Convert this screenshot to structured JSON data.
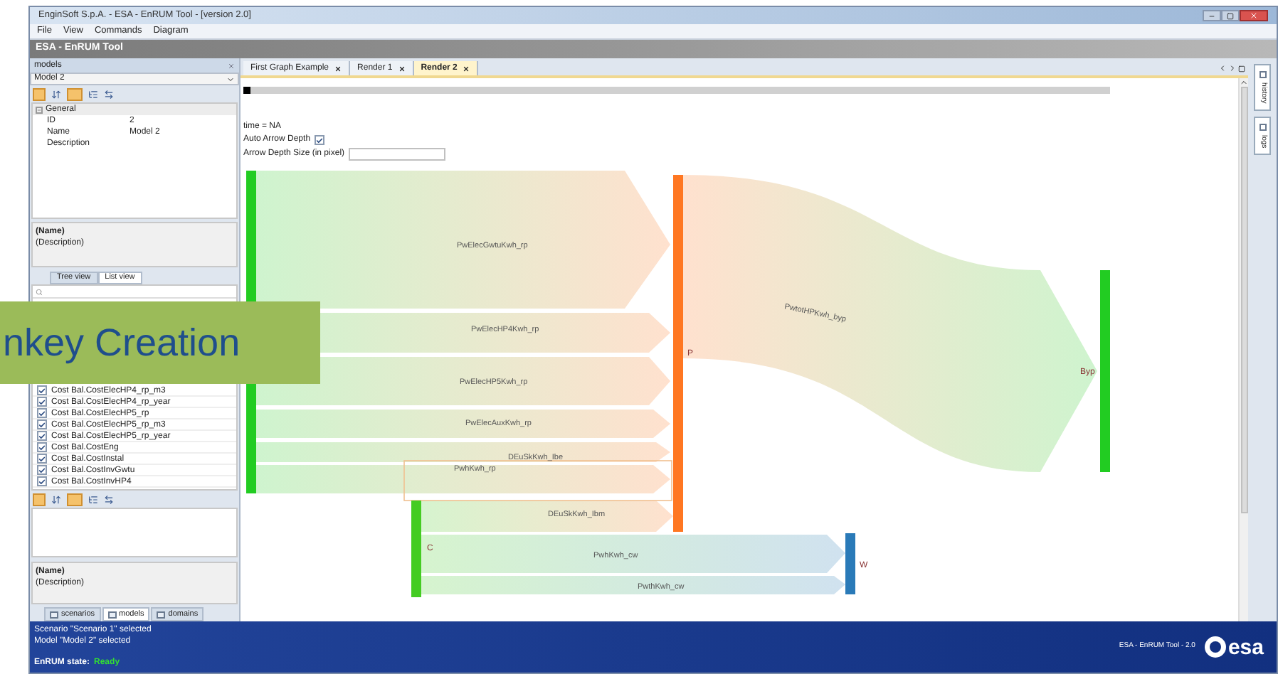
{
  "window": {
    "title": "EnginSoft S.p.A. - ESA - EnRUM Tool - [version 2.0]"
  },
  "menu": [
    "File",
    "View",
    "Commands",
    "Diagram"
  ],
  "app_header": "ESA - EnRUM Tool",
  "models_panel": {
    "title": "models",
    "model_select": "Model 2",
    "properties": {
      "group": "General",
      "rows": [
        {
          "name": "ID",
          "value": "2"
        },
        {
          "name": "Name",
          "value": "Model 2"
        },
        {
          "name": "Description",
          "value": ""
        }
      ]
    },
    "info_name": "(Name)",
    "info_description": "(Description)",
    "view_tabs": [
      {
        "label": "Tree view",
        "selected": false
      },
      {
        "label": "List view",
        "selected": true
      }
    ],
    "list_items": [
      {
        "label": "Cost Bal.CostElecHP4_rp_m3",
        "checked": true
      },
      {
        "label": "Cost Bal.CostElecHP4_rp_year",
        "checked": true
      },
      {
        "label": "Cost Bal.CostElecHP5_rp",
        "checked": true
      },
      {
        "label": "Cost Bal.CostElecHP5_rp_m3",
        "checked": true
      },
      {
        "label": "Cost Bal.CostElecHP5_rp_year",
        "checked": true
      },
      {
        "label": "Cost Bal.CostEng",
        "checked": true
      },
      {
        "label": "Cost Bal.CostInstal",
        "checked": true
      },
      {
        "label": "Cost Bal.CostInvGwtu",
        "checked": true
      },
      {
        "label": "Cost Bal.CostInvHP4",
        "checked": true
      }
    ],
    "info2_name": "(Name)",
    "info2_description": "(Description)",
    "bottom_tabs": [
      {
        "label": "scenarios",
        "selected": false
      },
      {
        "label": "models",
        "selected": true
      },
      {
        "label": "domains",
        "selected": false
      }
    ]
  },
  "doc_tabs": [
    {
      "label": "First Graph Example",
      "selected": false
    },
    {
      "label": "Render 1",
      "selected": false
    },
    {
      "label": "Render 2",
      "selected": true
    }
  ],
  "controls": {
    "time": "time = NA",
    "auto_arrow_label": "Auto Arrow Depth",
    "auto_arrow_checked": true,
    "depth_label": "Arrow Depth Size (in pixel)"
  },
  "time_slider": {
    "level": 0
  },
  "sankey": {
    "nodes": [
      {
        "color": "#22cc22"
      },
      {
        "label": "P",
        "color": "#ff7722"
      },
      {
        "label": "Byp",
        "color": "#22cc22"
      },
      {
        "label": "C",
        "color": "#44cc22"
      },
      {
        "label": "W",
        "color": "#2a7ab8"
      }
    ],
    "flows": [
      {
        "label": "PwElecGwtuKwh_rp"
      },
      {
        "label": "PwElecHP4Kwh_rp"
      },
      {
        "label": "PwElecHP5Kwh_rp"
      },
      {
        "label": "PwElecAuxKwh_rp"
      },
      {
        "label": "DEuSkKwh_Ibe"
      },
      {
        "label": "PwhKwh_rp"
      },
      {
        "label": "DEuSkKwh_Ibm"
      },
      {
        "label": "PwhKwh_cw"
      },
      {
        "label": "PwthKwh_cw"
      },
      {
        "label": "PwtotHPKwh_byp"
      }
    ]
  },
  "side_tabs": [
    "history",
    "logs"
  ],
  "status": {
    "lines": [
      "Scenario \"Scenario 1\" selected",
      "Model \"Model 2\" selected"
    ],
    "state_label": "EnRUM state:",
    "state_value": "Ready",
    "version": "ESA - EnRUM Tool - 2.0",
    "logo": "esa"
  },
  "overlay_caption": "nkey Creation"
}
